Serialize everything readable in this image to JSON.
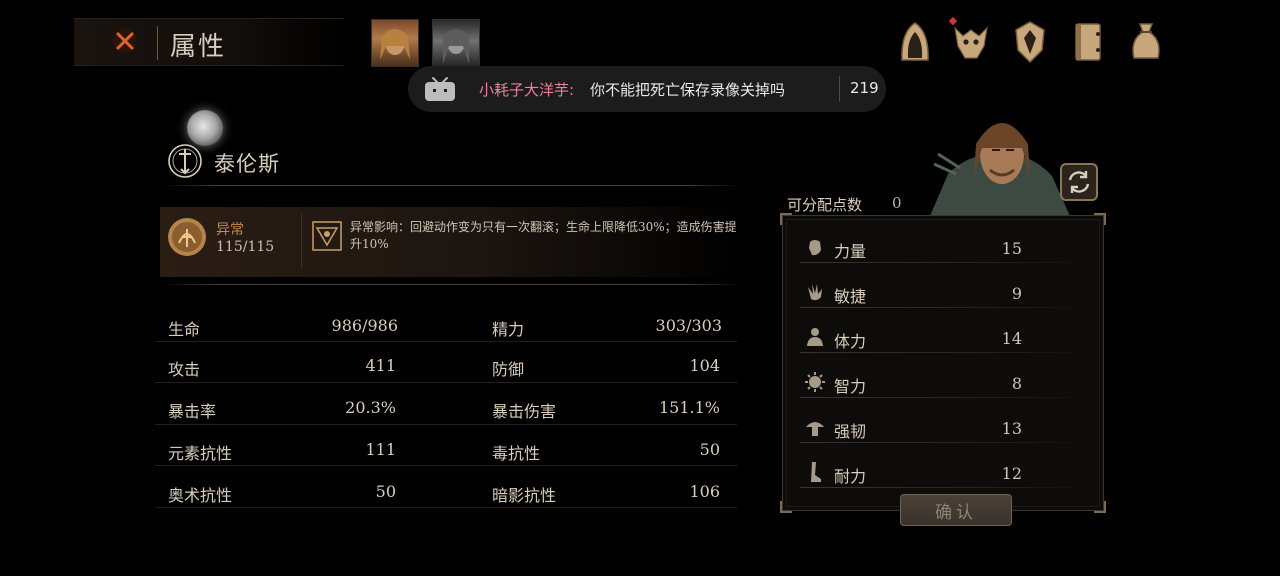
{
  "header": {
    "title": "属性",
    "close_icon": "close-x-icon",
    "party_portraits": [
      {
        "name": "portrait-blonde-hero",
        "active": true
      },
      {
        "name": "portrait-grey-heroine",
        "active": false
      }
    ],
    "menu_icons": [
      "hood-icon",
      "beast-skull-icon",
      "crest-shield-icon",
      "journal-icon",
      "pouch-icon"
    ],
    "menu_badge": "◆"
  },
  "danmaku": {
    "user": "小耗子大洋芋:",
    "message": "你不能把死亡保存录像关掉吗",
    "count": "219"
  },
  "character": {
    "name": "泰伦斯",
    "emblem_icon": "sword-emblem-icon"
  },
  "status": {
    "label": "异常",
    "value": "115/115",
    "effect_text": "异常影响：回避动作变为只有一次翻滚；生命上限降低30%；造成伤害提升10%"
  },
  "stats": [
    {
      "name": "生命",
      "value": "986/986"
    },
    {
      "name": "精力",
      "value": "303/303"
    },
    {
      "name": "攻击",
      "value": "411"
    },
    {
      "name": "防御",
      "value": "104"
    },
    {
      "name": "暴击率",
      "value": "20.3%"
    },
    {
      "name": "暴击伤害",
      "value": "151.1%"
    },
    {
      "name": "元素抗性",
      "value": "111"
    },
    {
      "name": "毒抗性",
      "value": "50"
    },
    {
      "name": "奥术抗性",
      "value": "50"
    },
    {
      "name": "暗影抗性",
      "value": "106"
    }
  ],
  "allocation": {
    "label": "可分配点数",
    "points": "0",
    "attributes": [
      {
        "name": "力量",
        "value": "15",
        "icon": "fist-icon"
      },
      {
        "name": "敏捷",
        "value": "9",
        "icon": "hand-icon"
      },
      {
        "name": "体力",
        "value": "14",
        "icon": "body-icon"
      },
      {
        "name": "智力",
        "value": "8",
        "icon": "mind-icon"
      },
      {
        "name": "强韧",
        "value": "13",
        "icon": "mushroom-icon"
      },
      {
        "name": "耐力",
        "value": "12",
        "icon": "leg-icon"
      }
    ],
    "confirm_label": "确认"
  },
  "colors": {
    "status_label": "#c58a46",
    "danmaku_user": "#f07f9c",
    "background": "#000000"
  }
}
